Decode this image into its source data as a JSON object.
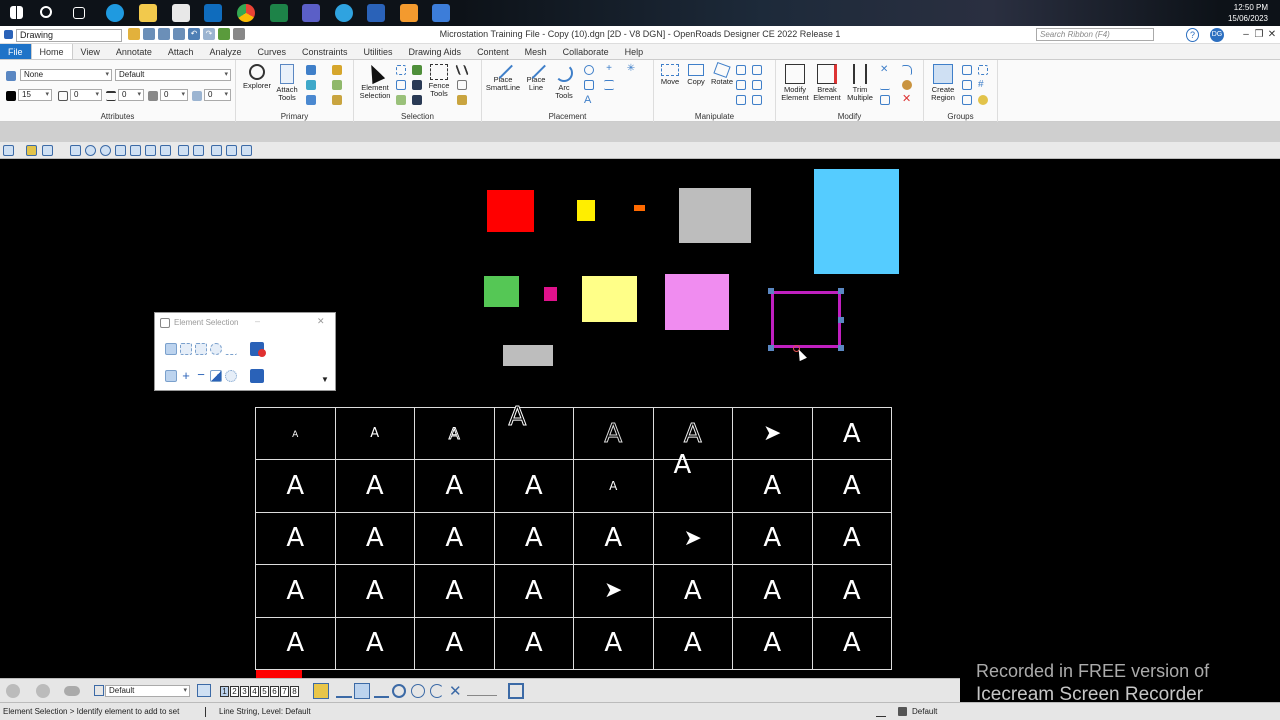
{
  "taskbar": {
    "clock_time": "12:50 PM",
    "clock_date": "15/06/2023"
  },
  "titlebar": {
    "workflow": "Drawing",
    "title": "Microstation Training File - Copy (10).dgn [2D - V8 DGN] - OpenRoads Designer CE 2022 Release 1",
    "search_placeholder": "Search Ribbon (F4)",
    "user_badge": "DG"
  },
  "menu": {
    "tabs": [
      "File",
      "Home",
      "View",
      "Annotate",
      "Attach",
      "Analyze",
      "Curves",
      "Constraints",
      "Utilities",
      "Drawing Aids",
      "Content",
      "Mesh",
      "Collaborate",
      "Help"
    ],
    "active": "Home"
  },
  "ribbon": {
    "attributes": {
      "level": "None",
      "style": "Default",
      "color": "15",
      "weight": "0",
      "linestyle": "0",
      "transparency": "0",
      "priority": "0",
      "label": "Attributes"
    },
    "primary": {
      "explorer": "Explorer",
      "attach_tools_1": "Attach",
      "attach_tools_2": "Tools",
      "label": "Primary"
    },
    "selection": {
      "element_1": "Element",
      "element_2": "Selection",
      "fence_1": "Fence",
      "fence_2": "Tools",
      "label": "Selection"
    },
    "placement": {
      "smartline_1": "Place",
      "smartline_2": "SmartLine",
      "line_1": "Place",
      "line_2": "Line",
      "arc_1": "Arc",
      "arc_2": "Tools",
      "label": "Placement"
    },
    "manipulate": {
      "move": "Move",
      "copy": "Copy",
      "rotate": "Rotate",
      "label": "Manipulate"
    },
    "modify": {
      "modify_1": "Modify",
      "modify_2": "Element",
      "break_1": "Break",
      "break_2": "Element",
      "trim_1": "Trim",
      "trim_2": "Multiple",
      "label": "Modify"
    },
    "groups": {
      "region_1": "Create",
      "region_2": "Region",
      "label": "Groups"
    }
  },
  "colors": {
    "red": "#ff0000",
    "yellow": "#ffee00",
    "orange": "#ff6a00",
    "gray": "#bdbdbd",
    "cyan": "#55ccff",
    "green": "#55c755",
    "magenta": "#e0128c",
    "pale_yellow": "#ffff88",
    "pink": "#f08cf0",
    "selection": "#c020c0"
  },
  "element_selection": {
    "title": "Element Selection"
  },
  "text_grid": {
    "glyph": "A",
    "arrow": "➤"
  },
  "bottom_toolbar": {
    "level": "Default",
    "views": [
      "1",
      "2",
      "3",
      "4",
      "5",
      "6",
      "7",
      "8"
    ]
  },
  "status": {
    "prompt": "Element Selection > Identify element to add to set",
    "element_info": "Line String, Level: Default",
    "active_level": "Default"
  },
  "watermark": {
    "line1": "Recorded in FREE version of",
    "line2": "Icecream  Screen  Recorder"
  }
}
